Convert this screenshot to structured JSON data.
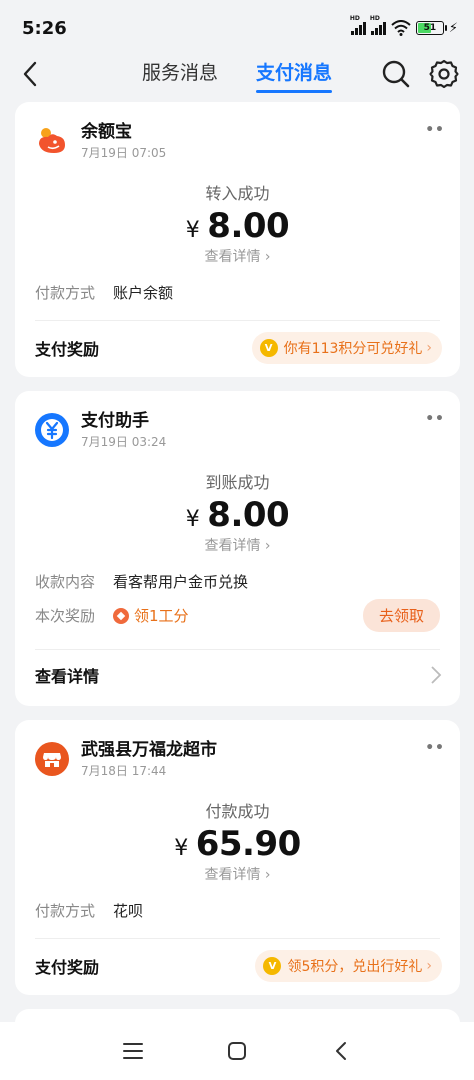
{
  "status_bar": {
    "time": "5:26",
    "battery": "51"
  },
  "header": {
    "tabs": [
      {
        "label": "服务消息",
        "active": false
      },
      {
        "label": "支付消息",
        "active": true
      }
    ],
    "icons": {
      "back": "back-arrow-icon",
      "search": "search-icon",
      "settings": "gear-icon"
    }
  },
  "cards": [
    {
      "merchant": "余额宝",
      "time": "7月19日 07:05",
      "status": "转入成功",
      "currency": "¥",
      "amount": "8.00",
      "detail_link": "查看详情",
      "fields": [
        {
          "key": "付款方式",
          "value": "账户余额"
        }
      ],
      "footer_label": "支付奖励",
      "reward": "你有113积分可兑好礼",
      "logo_color": "#f2542d"
    },
    {
      "merchant": "支付助手",
      "time": "7月19日 03:24",
      "status": "到账成功",
      "currency": "¥",
      "amount": "8.00",
      "detail_link": "查看详情",
      "fields": [
        {
          "key": "收款内容",
          "value": "看客帮用户金币兑换"
        },
        {
          "key": "本次奖励",
          "value": "领1工分"
        }
      ],
      "claim_button": "去领取",
      "footer_label": "查看详情",
      "logo_color": "#1677ff"
    },
    {
      "merchant": "武强县万福龙超市",
      "time": "7月18日 17:44",
      "status": "付款成功",
      "currency": "¥",
      "amount": "65.90",
      "detail_link": "查看详情",
      "fields": [
        {
          "key": "付款方式",
          "value": "花呗"
        }
      ],
      "footer_label": "支付奖励",
      "reward": "领5积分，兑出行好礼",
      "logo_color": "#e9561f"
    }
  ],
  "colors": {
    "accent": "#1677ff",
    "reward_text": "#e8711a",
    "background": "#f2f3f5"
  }
}
